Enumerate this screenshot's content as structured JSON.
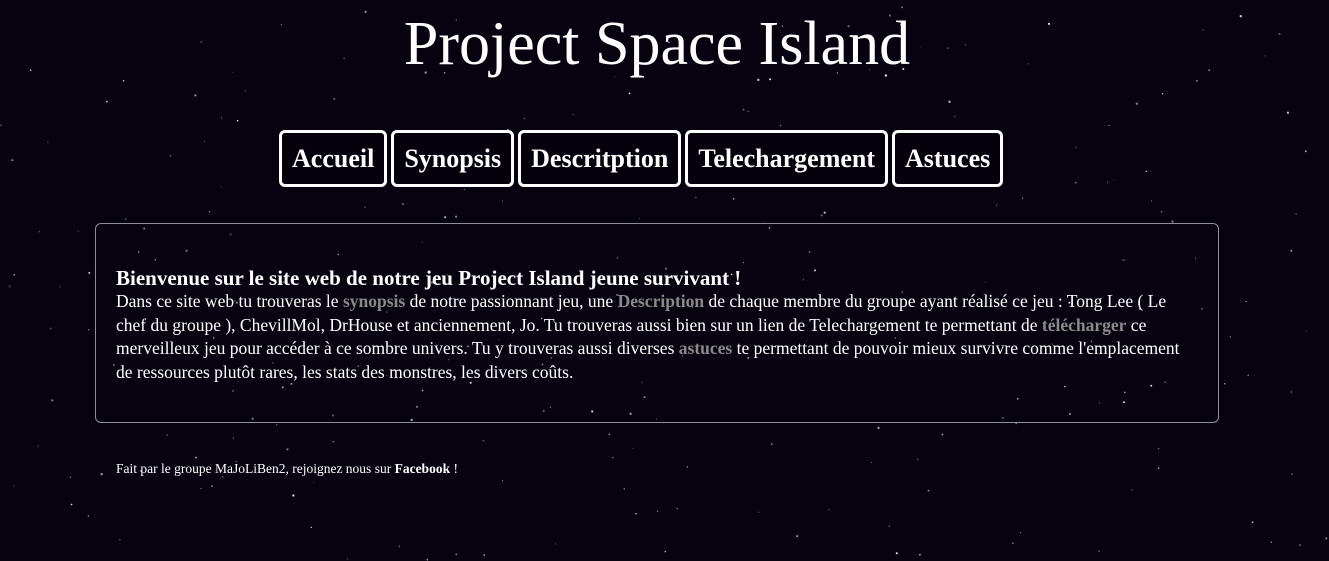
{
  "header": {
    "title": "Project Space Island"
  },
  "nav": {
    "items": [
      {
        "label": "Accueil"
      },
      {
        "label": "Synopsis"
      },
      {
        "label": "Descritption"
      },
      {
        "label": "Telechargement"
      },
      {
        "label": "Astuces"
      }
    ]
  },
  "main": {
    "heading": "Bienvenue sur le site web de notre jeu Project Island jeune survivant !",
    "intro": {
      "t1": "Dans ce site web tu trouveras le ",
      "link_synopsis": "synopsis",
      "t2": " de notre passionnant jeu, une ",
      "link_description": "Description",
      "t3": " de chaque membre du groupe ayant réalisé ce jeu : Tong Lee ( Le chef du groupe ), ChevillMol, DrHouse et anciennement, Jo. Tu trouveras aussi bien sur un lien de Telechargement te permettant de ",
      "link_telecharger": "télécharger",
      "t4": " ce merveilleux jeu pour accéder à ce sombre univers. Tu y trouveras aussi diverses ",
      "link_astuces": "astuces",
      "t5": " te permettant de pouvoir mieux survivre comme l'emplacement de ressources plutôt rares, les stats des monstres, les divers coûts."
    }
  },
  "footer": {
    "text_before": "Fait par le groupe MaJoLiBen2, rejoignez nous sur ",
    "link_facebook": "Facebook",
    "text_after": " !"
  },
  "colors": {
    "background": "#080210",
    "text": "#ffffff",
    "link_gray": "#8a8a8a",
    "box_border": "#8f8f9a"
  }
}
